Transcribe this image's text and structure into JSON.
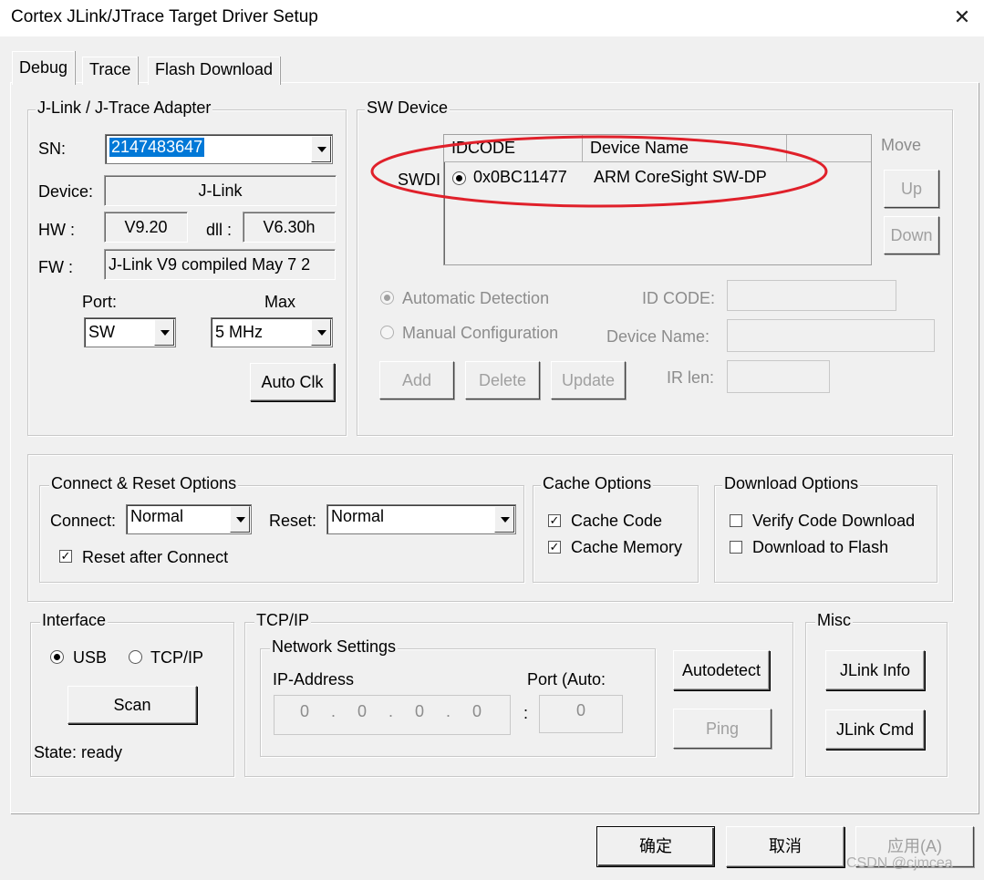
{
  "window": {
    "title": "Cortex JLink/JTrace Target Driver Setup",
    "close_glyph": "✕"
  },
  "tabs": [
    "Debug",
    "Trace",
    "Flash Download"
  ],
  "adapter": {
    "legend": "J-Link / J-Trace Adapter",
    "sn_label": "SN:",
    "sn_value": "2147483647",
    "device_label": "Device:",
    "device_value": "J-Link",
    "hw_label": "HW :",
    "hw_value": "V9.20",
    "dll_label": "dll :",
    "dll_value": "V6.30h",
    "fw_label": "FW :",
    "fw_value": "J-Link V9 compiled May  7 2",
    "port_label": "Port:",
    "port_value": "SW",
    "max_label": "Max",
    "max_value": "5 MHz",
    "autoclk": "Auto Clk"
  },
  "sw_device": {
    "legend": "SW Device",
    "row_label": "SWDI",
    "col_idcode": "IDCODE",
    "col_name": "Device Name",
    "row_idcode": "0x0BC11477",
    "row_name": "ARM CoreSight SW-DP",
    "move": "Move",
    "up": "Up",
    "down": "Down",
    "auto_detect": "Automatic Detection",
    "manual": "Manual Configuration",
    "id_code_label": "ID CODE:",
    "device_name_label": "Device Name:",
    "ir_len_label": "IR len:",
    "add": "Add",
    "delete": "Delete",
    "update": "Update",
    "highlight_color": "#e0202a"
  },
  "connect": {
    "legend": "Connect & Reset Options",
    "connect_label": "Connect:",
    "connect_value": "Normal",
    "reset_label": "Reset:",
    "reset_value": "Normal",
    "reset_after": "Reset after Connect"
  },
  "cache": {
    "legend": "Cache Options",
    "code": "Cache Code",
    "memory": "Cache Memory"
  },
  "download": {
    "legend": "Download Options",
    "verify": "Verify Code Download",
    "flash": "Download to Flash"
  },
  "interface": {
    "legend": "Interface",
    "usb": "USB",
    "tcpip": "TCP/IP",
    "scan": "Scan",
    "state": "State: ready"
  },
  "tcp": {
    "legend": "TCP/IP",
    "network": "Network Settings",
    "ip_label": "IP-Address",
    "port_label": "Port (Auto:",
    "ip": [
      "0",
      "0",
      "0",
      "0"
    ],
    "port": "0",
    "colon": ":",
    "autodetect": "Autodetect",
    "ping": "Ping"
  },
  "misc": {
    "legend": "Misc",
    "info": "JLink Info",
    "cmd": "JLink Cmd"
  },
  "footer": {
    "ok": "确定",
    "cancel": "取消",
    "apply": "应用(A)",
    "watermark": "CSDN @cjmcea"
  },
  "checkmark": "✓"
}
